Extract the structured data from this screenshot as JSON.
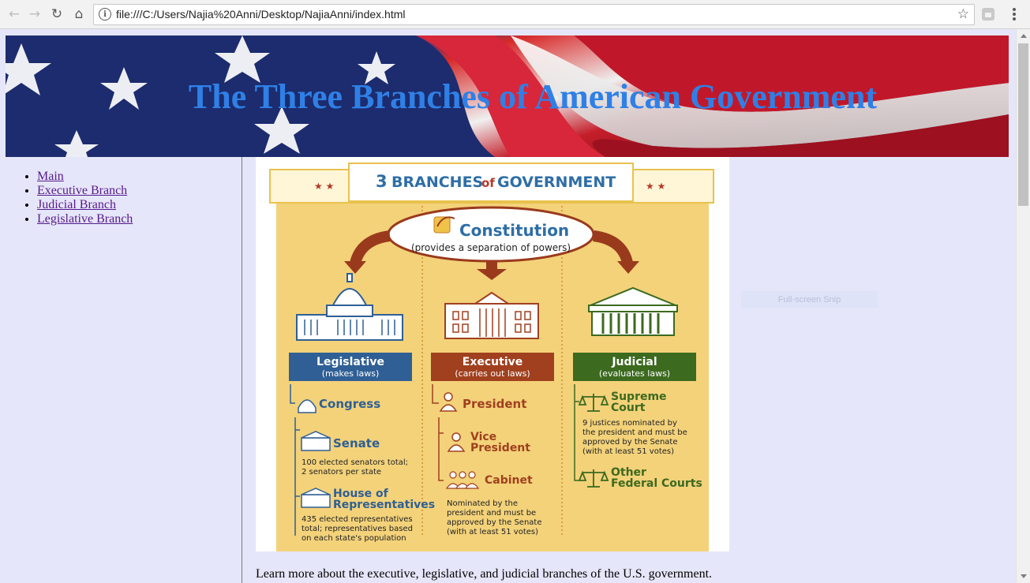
{
  "browser": {
    "url": "file:///C:/Users/Najia%20Anni/Desktop/NajiaAnni/index.html"
  },
  "page": {
    "title": "The Three Branches of American Government",
    "nav": [
      {
        "label": "Main"
      },
      {
        "label": "Executive Branch"
      },
      {
        "label": "Judicial Branch"
      },
      {
        "label": "Legislative Branch"
      }
    ],
    "caption": "Learn more about the executive, legislative, and judicial branches of the U.S. government."
  },
  "overlay": {
    "snip_label": "Full-screen Snip"
  },
  "infographic": {
    "header_num": "3",
    "header_title": "BRANCHES",
    "header_of": "of",
    "header_gov": "GOVERNMENT",
    "constitution": "Constitution",
    "constitution_note": "(provides a separation of powers)",
    "legislative": "Legislative",
    "legislative_role": "(makes laws)",
    "executive": "Executive",
    "executive_role": "(carries out laws)",
    "judicial": "Judicial",
    "judicial_role": "(evaluates laws)",
    "congress": "Congress",
    "senate": "Senate",
    "senate_note_1": "100 elected senators total;",
    "senate_note_2": "2 senators per state",
    "house_1": "House of",
    "house_2": "Representatives",
    "house_note_1": "435 elected representatives",
    "house_note_2": "total; representatives based",
    "house_note_3": "on each state's population",
    "president": "President",
    "vice_1": "Vice",
    "vice_2": "President",
    "cabinet": "Cabinet",
    "cabinet_note_1": "Nominated by the",
    "cabinet_note_2": "president and must be",
    "cabinet_note_3": "approved by the Senate",
    "cabinet_note_4": "(with at least 51 votes)",
    "supreme_1": "Supreme",
    "supreme_2": "Court",
    "supreme_note_1": "9 justices nominated by",
    "supreme_note_2": "the president and must be",
    "supreme_note_3": "approved by the Senate",
    "supreme_note_4": "(with at least 51 votes)",
    "other_1": "Other",
    "other_2": "Federal Courts",
    "colors": {
      "legislative": "#2f5f95",
      "executive": "#a0401f",
      "judicial": "#3c6a1f",
      "background": "#f3d27a"
    }
  }
}
